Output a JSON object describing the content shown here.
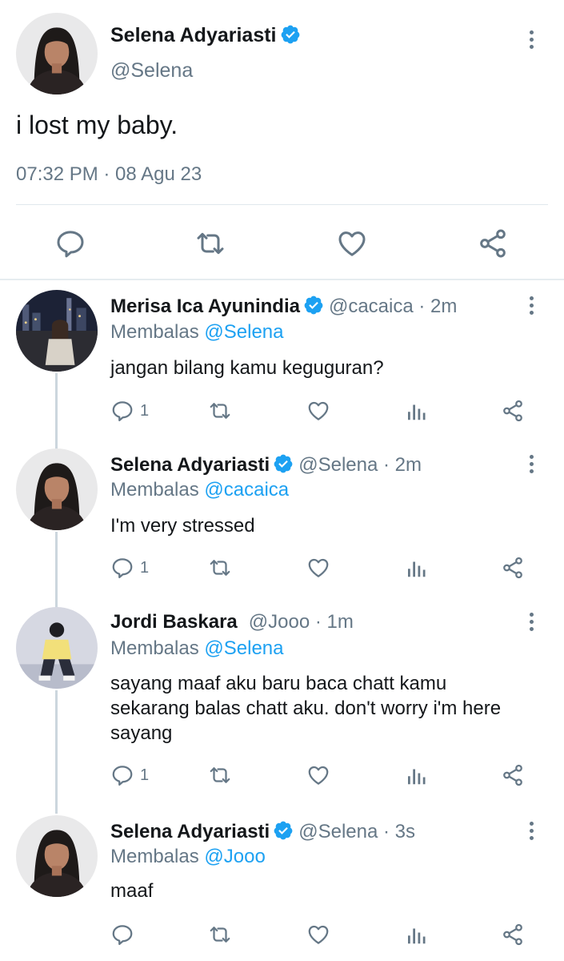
{
  "colors": {
    "accent": "#1da1f2",
    "muted": "#657786",
    "text": "#14171a",
    "divider": "#e1e8ed"
  },
  "main_tweet": {
    "author_name": "Selena Adyariasti",
    "author_handle": "@Selena",
    "verified": true,
    "text": "i lost my baby.",
    "timestamp": "07:32 PM · 08 Agu 23",
    "actions": [
      "reply-icon",
      "retweet-icon",
      "like-icon",
      "share-icon"
    ]
  },
  "replies": [
    {
      "author_name": "Merisa Ica Ayunindia",
      "verified": true,
      "handle_time": "@cacaica · 2m",
      "replying_prefix": "Membalas",
      "replying_to": "@Selena",
      "text": "jangan bilang kamu keguguran?",
      "reply_count": "1"
    },
    {
      "author_name": "Selena Adyariasti",
      "verified": true,
      "handle_time": "@Selena · 2m",
      "replying_prefix": "Membalas",
      "replying_to": "@cacaica",
      "text": "I'm very stressed",
      "reply_count": "1"
    },
    {
      "author_name": "Jordi Baskara",
      "verified": false,
      "handle_time": "@Jooo · 1m",
      "replying_prefix": "Membalas",
      "replying_to": "@Selena",
      "text": "sayang maaf aku baru baca chatt kamu sekarang balas chatt aku. don't worry i'm here sayang",
      "reply_count": "1"
    },
    {
      "author_name": "Selena Adyariasti",
      "verified": true,
      "handle_time": "@Selena · 3s",
      "replying_prefix": "Membalas",
      "replying_to": "@Jooo",
      "text": "maaf",
      "reply_count": ""
    }
  ]
}
